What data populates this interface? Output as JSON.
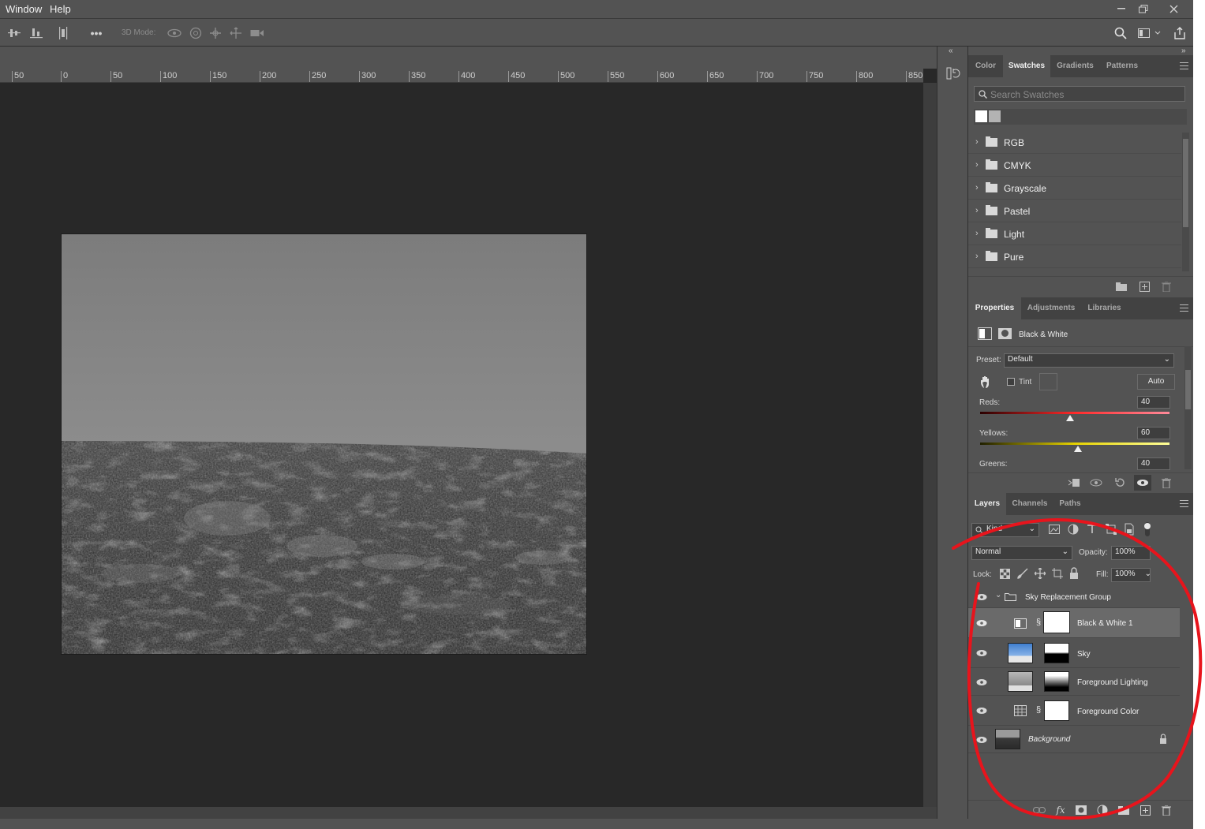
{
  "menubar": {
    "items": [
      "Window",
      "Help"
    ],
    "controls": [
      "minimize",
      "restore",
      "close"
    ]
  },
  "options_bar": {
    "mode_label": "3D Mode:",
    "more_label": "•••"
  },
  "ruler": {
    "labels": [
      "50",
      "0",
      "50",
      "100",
      "150",
      "200",
      "250",
      "300",
      "350",
      "400",
      "450",
      "500",
      "550",
      "600",
      "650",
      "700",
      "750",
      "800",
      "850"
    ]
  },
  "swatches_panel": {
    "tabs": [
      "Color",
      "Swatches",
      "Gradients",
      "Patterns"
    ],
    "active_tab": "Swatches",
    "search_placeholder": "Search Swatches",
    "recent_colors": [
      "#ffffff",
      "#b3b3b3"
    ],
    "folders": [
      "RGB",
      "CMYK",
      "Grayscale",
      "Pastel",
      "Light",
      "Pure"
    ]
  },
  "properties_panel": {
    "tabs": [
      "Properties",
      "Adjustments",
      "Libraries"
    ],
    "active_tab": "Properties",
    "adjustment_name": "Black & White",
    "preset_label": "Preset:",
    "preset_value": "Default",
    "tint_label": "Tint",
    "auto_label": "Auto",
    "sliders": [
      {
        "label": "Reds:",
        "value": "40",
        "fraction": 0.477,
        "gradient": [
          "#2a0000",
          "#ff2a2a",
          "#ff8a9a"
        ]
      },
      {
        "label": "Yellows:",
        "value": "60",
        "fraction": 0.518,
        "gradient": [
          "#1f1f00",
          "#e6d200",
          "#ffff9a"
        ]
      },
      {
        "label": "Greens:",
        "value": "40",
        "fraction": 0.477,
        "gradient": [
          "#002200",
          "#22cc22",
          "#9aff9a"
        ]
      }
    ]
  },
  "layers_panel": {
    "tabs": [
      "Layers",
      "Channels",
      "Paths"
    ],
    "active_tab": "Layers",
    "filter_label": "Kind",
    "blend_mode": "Normal",
    "opacity_label": "Opacity:",
    "opacity_value": "100%",
    "lock_label": "Lock:",
    "fill_label": "Fill:",
    "fill_value": "100%",
    "layers": [
      {
        "name": "Sky Replacement Group",
        "type": "group"
      },
      {
        "name": "Black & White 1",
        "type": "adjustment",
        "selected": true
      },
      {
        "name": "Sky",
        "type": "pixel"
      },
      {
        "name": "Foreground Lighting",
        "type": "pixel"
      },
      {
        "name": "Foreground Color",
        "type": "adjustment"
      },
      {
        "name": "Background",
        "type": "background",
        "locked": true
      }
    ]
  },
  "colors": {
    "annotation_red": "#e8141c",
    "panel_bg": "#535353",
    "canvas_bg": "#282828",
    "selected_row": "#6a6a6a"
  }
}
